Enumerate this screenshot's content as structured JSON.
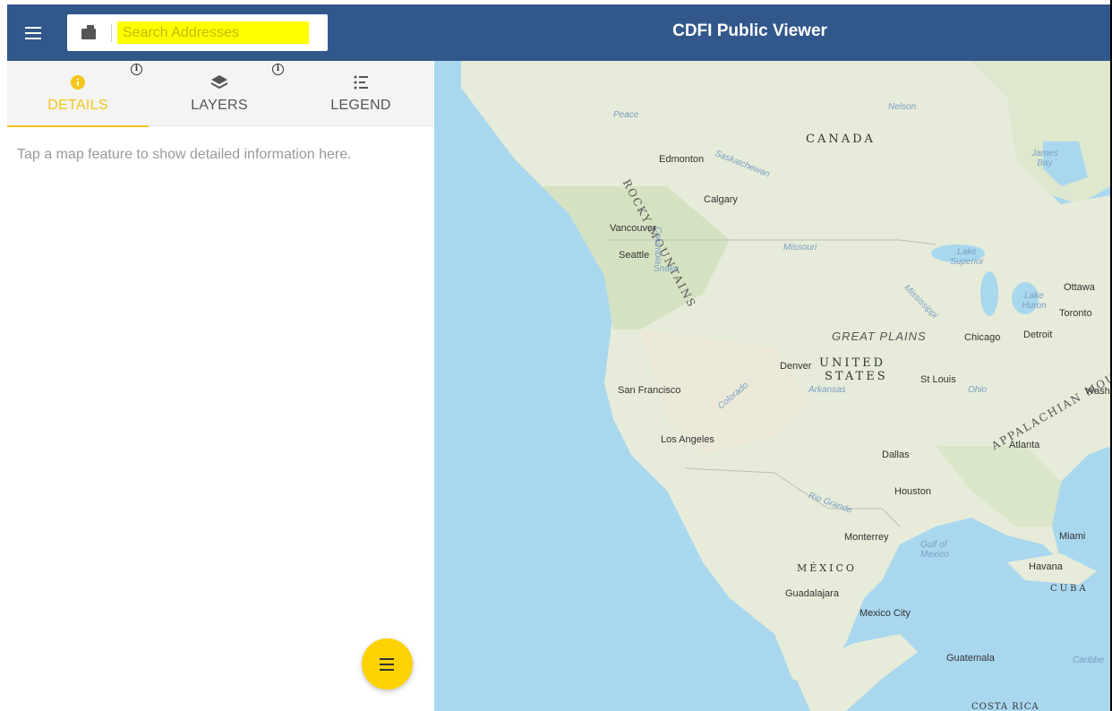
{
  "header": {
    "title": "CDFI Public Viewer",
    "menu_icon": "hamburger-menu-icon",
    "search": {
      "placeholder": "Search Addresses",
      "value": "",
      "icon": "briefcase-icon"
    },
    "colors": {
      "bar": "#32578b",
      "highlight": "#ffff00"
    }
  },
  "panel": {
    "tabs": [
      {
        "label": "DETAILS",
        "icon": "info-circle-icon",
        "active": true
      },
      {
        "label": "LAYERS",
        "icon": "layers-icon",
        "active": false
      },
      {
        "label": "LEGEND",
        "icon": "legend-list-icon",
        "active": false
      }
    ],
    "message": "Tap a map feature to show detailed information here.",
    "accent": "#f5c518",
    "fab_icon": "menu-icon"
  },
  "map": {
    "labels": {
      "canada": "CANADA",
      "us_line1": "UNITED",
      "us_line2": "STATES",
      "mexico": "MÉXICO",
      "cuba": "CUBA",
      "costa_rica": "COSTA RICA",
      "great_plains": "GREAT PLAINS",
      "rocky": "ROCKY MOUNTAINS",
      "appalachian": "APPALACHIAN MOUN",
      "edmonton": "Edmonton",
      "calgary": "Calgary",
      "vancouver": "Vancouver",
      "seattle": "Seattle",
      "san_francisco": "San Francisco",
      "los_angeles": "Los Angeles",
      "denver": "Denver",
      "dallas": "Dallas",
      "houston": "Houston",
      "st_louis": "St Louis",
      "chicago": "Chicago",
      "detroit": "Detroit",
      "toronto": "Toronto",
      "ottawa": "Ottawa",
      "atlanta": "Atlanta",
      "miami": "Miami",
      "havana": "Havana",
      "monterrey": "Monterrey",
      "guadalajara": "Guadalajara",
      "mexico_city": "Mexico City",
      "guatemala": "Guatemala",
      "wash": "Wash",
      "peace": "Peace",
      "nelson": "Nelson",
      "saskatchewan": "Saskatchewan",
      "james_bay": "James Bay",
      "missouri": "Missouri",
      "lake_superior": "Lake Superior",
      "lake_huron": "Lake Huron",
      "mississippi": "Mississippi",
      "columbia": "Columbia",
      "snake": "Snake",
      "colorado": "Colorado",
      "arkansas": "Arkansas",
      "ohio": "Ohio",
      "rio_grande": "Rio Grande",
      "gulf": "Gulf of Mexico",
      "caribbean": "Caribbe"
    }
  }
}
